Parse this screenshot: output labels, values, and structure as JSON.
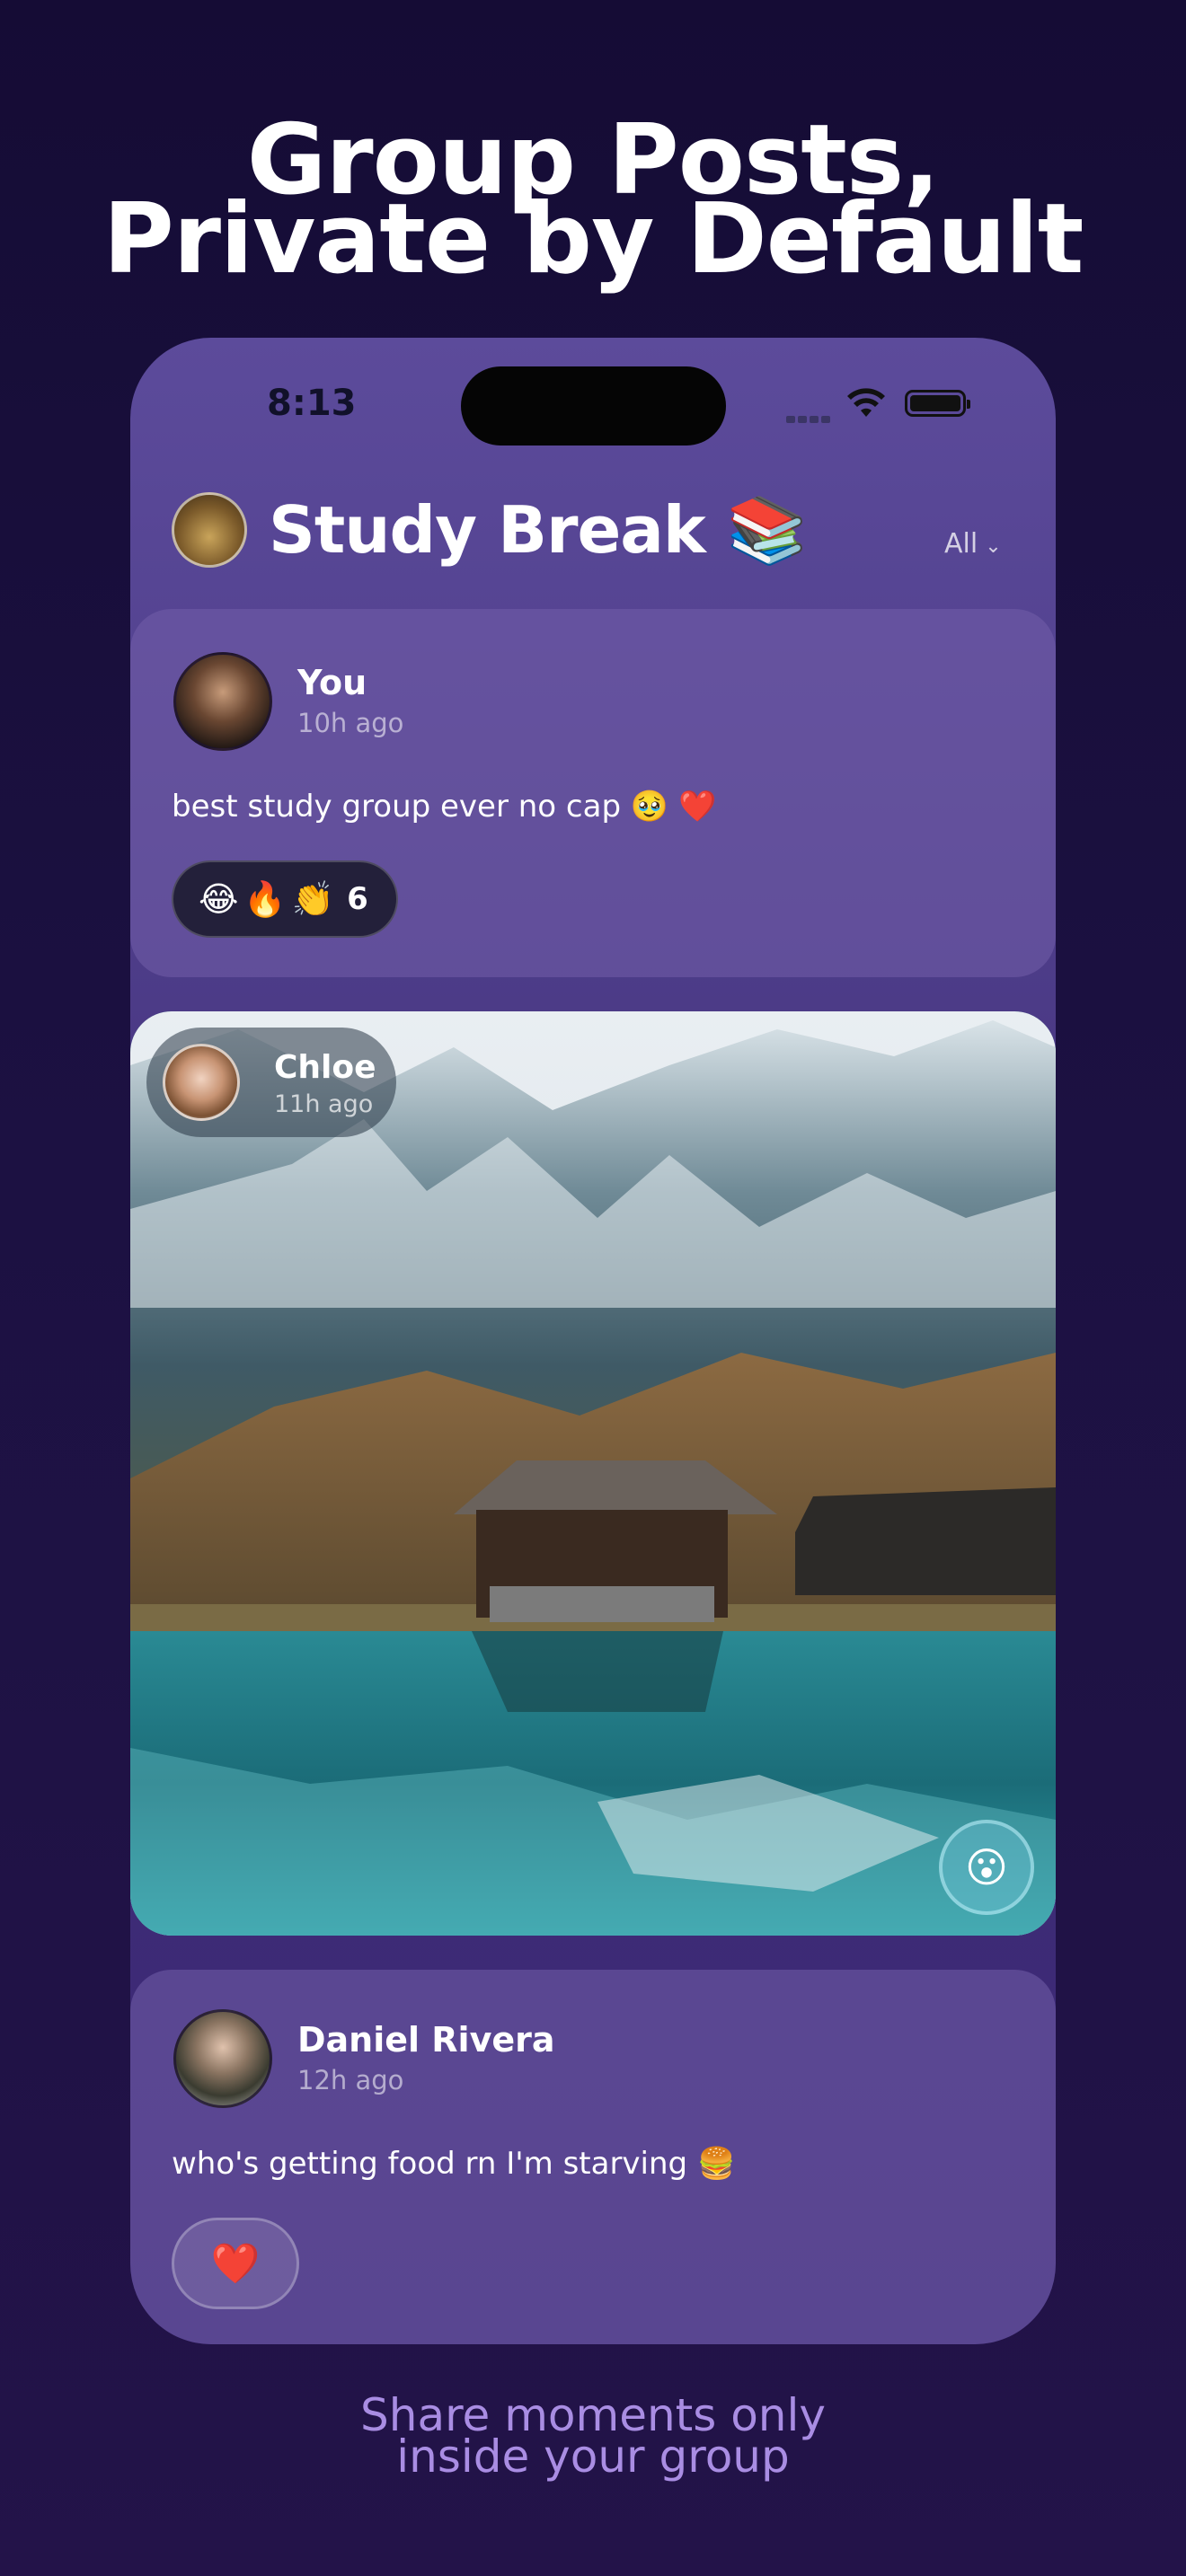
{
  "headline": {
    "line1": "Group Posts,",
    "line2": "Private by Default"
  },
  "status_bar": {
    "time": "8:13"
  },
  "group": {
    "title": "Study Break 📚",
    "filter_label": "All"
  },
  "posts": [
    {
      "author": "You",
      "time": "10h ago",
      "text": "best study group ever no cap 🥹 ❤️",
      "reactions": [
        "😂",
        "🔥",
        "👏"
      ],
      "reaction_count": "6"
    },
    {
      "author": "Chloe",
      "time": "11h ago",
      "reaction_emoji": "😮"
    },
    {
      "author": "Daniel Rivera",
      "time": "12h ago",
      "text": "who's getting food rn I'm starving 🍔",
      "reaction": "❤️"
    }
  ],
  "tagline": {
    "line1": "Share moments only",
    "line2": "inside your group"
  }
}
